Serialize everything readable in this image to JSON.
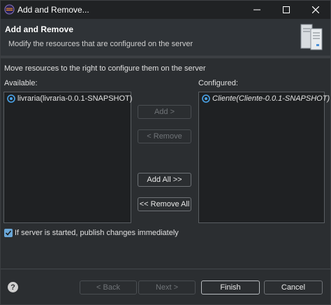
{
  "window": {
    "title": "Add and Remove...",
    "app_icon": "eclipse-icon",
    "controls": [
      "minimize-icon",
      "maximize-icon",
      "close-icon"
    ]
  },
  "banner": {
    "title": "Add and Remove",
    "description": "Modify the resources that are configured on the server",
    "art_icon": "server-icon"
  },
  "instructions": "Move resources to the right to configure them on the server",
  "available": {
    "label": "Available:",
    "items": [
      {
        "label": "livraria(livraria-0.0.1-SNAPSHOT)",
        "icon": "module-icon",
        "italic": false
      }
    ]
  },
  "configured": {
    "label": "Configured:",
    "items": [
      {
        "label": "Cliente(Cliente-0.0.1-SNAPSHOT)",
        "icon": "module-icon",
        "italic": true
      }
    ]
  },
  "buttons": {
    "add": "Add >",
    "remove": "< Remove",
    "add_all": "Add All >>",
    "remove_all": "<< Remove All"
  },
  "publish_option": {
    "label": "If server is started, publish changes immediately",
    "checked": true
  },
  "footer": {
    "help_glyph": "?",
    "back": "< Back",
    "next": "Next >",
    "finish": "Finish",
    "cancel": "Cancel"
  },
  "colors": {
    "background": "#2b2e31",
    "accent": "#6aa7d8",
    "listbox": "#1f2123"
  }
}
